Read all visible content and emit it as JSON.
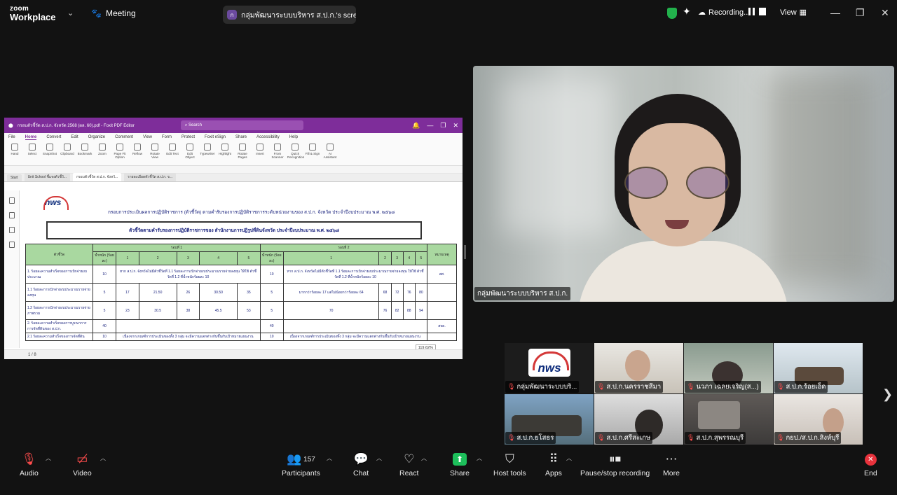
{
  "app": {
    "brand_line1": "zoom",
    "brand_line2": "Workplace",
    "meeting_label": "Meeting"
  },
  "share_banner": {
    "text": "กลุ่มพัฒนาระบบบริหาร ส.ป.ก.'s screer"
  },
  "top_right": {
    "recording_label": "Recording...",
    "view_label": "View"
  },
  "pdf": {
    "title": "กรอบตัวชี้วัด ส.ป.ก. จังหวัด 2568 (ผล. 60).pdf - Foxit PDF Editor",
    "search_placeholder": "Search",
    "menu": [
      "File",
      "Home",
      "Convert",
      "Edit",
      "Organize",
      "Comment",
      "View",
      "Form",
      "Protect",
      "Foxit eSign",
      "Share",
      "Accessibility",
      "Help"
    ],
    "ribbon": [
      "Hand",
      "Select",
      "SnapShot",
      "Clipboard",
      "Bookmark",
      "Zoom",
      "Page Fit Option",
      "Reflow",
      "Rotate View",
      "Edit Text",
      "Edit Object",
      "Typewriter",
      "Highlight",
      "Rotate Pages",
      "Insert",
      "From Scanner",
      "Quick Recognition",
      "Fill & Sign",
      "AI Assistant"
    ],
    "tabs": [
      "Start",
      "Unit School ชี้แจงตัวชี้วั...",
      "กรอบตัวชี้วัด ส.ป.ก. จังหวั...",
      "รายละเอียดตัวชี้วัด ส.ป.ก. จ..."
    ],
    "doc_heading": "กรอบการประเมินผลการปฏิบัติราชการ (ตัวชี้วัด) ตามคำรับรองการปฏิบัติราชการระดับหน่วยงานของ ส.ป.ก. จังหวัด ประจำปีงบประมาณ พ.ศ. ๒๕๖๘",
    "doc_box": "ตัวชี้วัดตามคำรับรองการปฏิบัติราชการของ สำนักงานการปฏิรูปที่ดินจังหวัด ประจำปีงบประมาณ พ.ศ. ๒๕๖๘",
    "table": {
      "header": [
        "ตัวชี้วัด",
        "รอบที่ 1",
        "รอบที่ 2",
        "หมายเหตุ"
      ],
      "subheader": [
        "น้ำหนัก (ร้อยละ)",
        "1",
        "2",
        "3",
        "4",
        "5",
        "น้ำหนัก (ร้อยละ)",
        "1",
        "2",
        "3",
        "4",
        "5"
      ],
      "rows": [
        [
          "1. ร้อยละความสำเร็จของการเบิกจ่ายงบประมาณ",
          "10",
          "หาก ส.ป.ก. จังหวัดไม่มีตัวชี้วัดที่ 1.1 ร้อยละการเบิกจ่ายงบประมาณรายจ่ายลงทุน ให้ใช้ ตัวชี้วัดที่ 1.2 ที่น้ำหนักร้อยละ 10",
          "10",
          "หาก ส.ป.ก. จังหวัดไม่มีตัวชี้วัดที่ 1.1 ร้อยละการเบิกจ่ายงบประมาณรายจ่ายลงทุน ให้ใช้ ตัวชี้วัดที่ 1.2 ที่น้ำหนักร้อยละ 10",
          "สศ."
        ],
        [
          "1.1 ร้อยละการเบิกจ่ายงบประมาณรายจ่ายลงทุน",
          "5",
          "17",
          "21.50",
          "26",
          "30.50",
          "35",
          "5",
          "มากกว่าร้อยละ 17 แต่ไม่น้อยกว่าร้อยละ 64",
          "68",
          "72",
          "76",
          "80"
        ],
        [
          "1.2 ร้อยละการเบิกจ่ายงบประมาณรายจ่ายภาพรวม",
          "5",
          "23",
          "30.5",
          "38",
          "45.5",
          "53",
          "5",
          "70",
          "76",
          "82",
          "88",
          "94"
        ],
        [
          "2. ร้อยละความสำเร็จของการบูรณาการการจัดที่ดินของ ส.ป.ก.",
          "40",
          "40",
          "สจด."
        ],
        [
          "2.1 ร้อยละความสำเร็จของการจัดที่ดิน",
          "10",
          "เนื่องจากเกณฑ์การประเมินของทั้ง 3 กลุ่ม จะมีความแตกต่างกันขึ้นกับเป้าหมายแผนงาน",
          "10",
          "เนื่องจากเกณฑ์การประเมินของทั้ง 3 กลุ่ม จะมีความแตกต่างกันขึ้นกับเป้าหมายแผนงาน"
        ]
      ]
    },
    "page_indicator": "1 / 8",
    "zoom_level": "119.62%"
  },
  "speaker": {
    "name": "กลุ่มพัฒนาระบบบริหาร ส.ป.ก."
  },
  "thumbnails": [
    {
      "name": "กลุ่มพัฒนาระบบบริ...",
      "logo_text": "nws"
    },
    {
      "name": "ส.ป.ก.นครราชสีมา"
    },
    {
      "name": "นวภา เฉลยเจริญ(ส...)"
    },
    {
      "name": "ส.ป.ก.ร้อยเอ็ด"
    },
    {
      "name": "ส.ป.ก.ยโสธร"
    },
    {
      "name": "ส.ป.ก.ศรีสะเกษ"
    },
    {
      "name": "ส.ป.ก.สุพรรณบุรี"
    },
    {
      "name": "กยป./ส.ป.ก.สิงห์บุรี"
    }
  ],
  "toolbar": {
    "audio": "Audio",
    "video": "Video",
    "participants": "Participants",
    "participants_count": "157",
    "chat": "Chat",
    "react": "React",
    "share": "Share",
    "host_tools": "Host tools",
    "apps": "Apps",
    "pause_recording": "Pause/stop recording",
    "more": "More",
    "end": "End"
  },
  "colors": {
    "share_green": "#1dbf5b",
    "end_red": "#e8323c",
    "pdf_purple": "#7e2d9a",
    "table_header_green": "#a9d8a0"
  }
}
